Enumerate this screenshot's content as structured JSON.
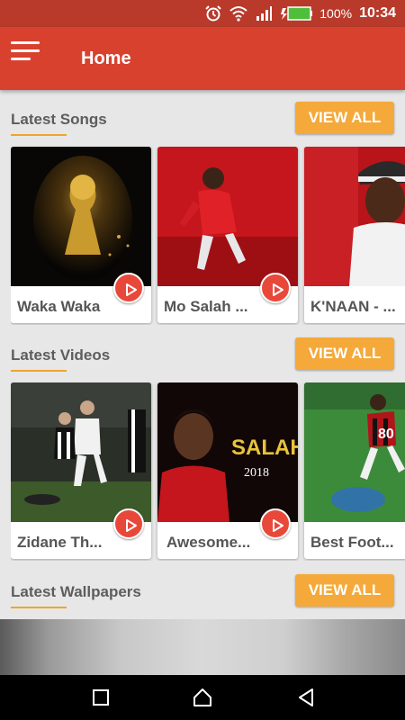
{
  "status_bar": {
    "battery_percent": "100%",
    "time": "10:34",
    "icons": [
      "alarm-icon",
      "wifi-icon",
      "signal-icon",
      "battery-charging-icon"
    ]
  },
  "app_bar": {
    "title": "Home",
    "menu_icon": "hamburger-menu-icon"
  },
  "sections": {
    "songs": {
      "title": "Latest Songs",
      "view_all": "VIEW ALL",
      "items": [
        {
          "label": "Waka Waka"
        },
        {
          "label": "Mo Salah ..."
        },
        {
          "label": "K'NAAN - ..."
        }
      ]
    },
    "videos": {
      "title": "Latest Videos",
      "view_all": "VIEW ALL",
      "items": [
        {
          "label": "Zidane Th..."
        },
        {
          "label": "Awesome..."
        },
        {
          "label": "Best Foot..."
        }
      ]
    },
    "wallpapers": {
      "title": "Latest Wallpapers",
      "view_all": "VIEW ALL"
    }
  },
  "video_card_overlay": {
    "salah_text": "SALAH",
    "year_text": "2018",
    "jersey_number": "80"
  },
  "nav_bar": {
    "icons": [
      "recent-apps-icon",
      "home-icon",
      "back-icon"
    ]
  },
  "colors": {
    "status_bar": "#b93a2b",
    "app_bar": "#d9412f",
    "accent": "#f4a93a",
    "play_button": "#e8483a",
    "background": "#e7e7e7"
  }
}
